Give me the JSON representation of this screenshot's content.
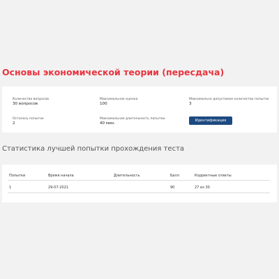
{
  "page": {
    "title": "Основы экономической теории (пересдача)",
    "bg_color": "#f2f2f2",
    "accent_color": "#e8343f",
    "button_color": "#1d4a80"
  },
  "info": {
    "questions_label": "Количество вопросов",
    "questions_value": "30 вопросов",
    "max_score_label": "Максимальная оценка",
    "max_score_value": "100",
    "max_attempts_label": "Максимально допустимое количество попыток",
    "max_attempts_value": "3",
    "remaining_label": "Осталось попыток",
    "remaining_value": "2",
    "max_duration_label": "Максимальная длительность попытки",
    "max_duration_value": "40 мин.",
    "identify_button": "Идентификация"
  },
  "stats": {
    "title": "Статистика лучшей попытки прохождения теста",
    "columns": [
      "Попытки",
      "Время начала",
      "Длительность",
      "Балл",
      "Корректные ответы"
    ],
    "rows": [
      [
        "1",
        "29-07-2021",
        "",
        "90",
        "27 из 30"
      ]
    ]
  }
}
